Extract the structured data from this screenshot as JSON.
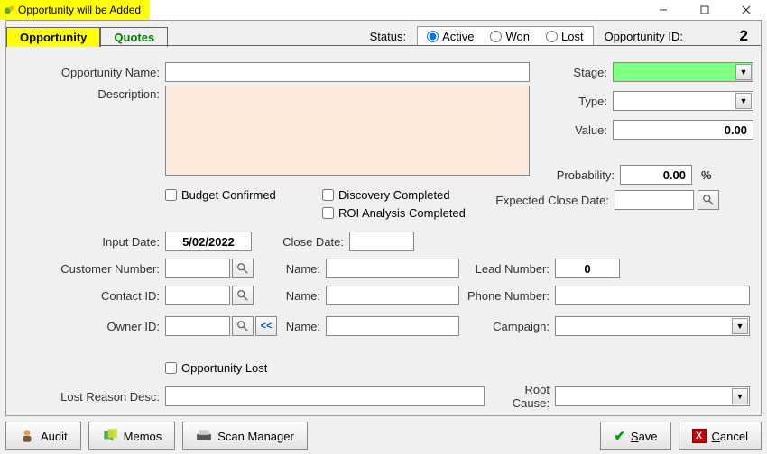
{
  "window": {
    "title": "Opportunity will be Added"
  },
  "tabs": {
    "opportunity": "Opportunity",
    "quotes": "Quotes"
  },
  "status": {
    "label": "Status:",
    "active": "Active",
    "won": "Won",
    "lost": "Lost",
    "selected": "active"
  },
  "opp_id": {
    "label": "Opportunity ID:",
    "value": "2"
  },
  "labels": {
    "opp_name": "Opportunity Name:",
    "description": "Description:",
    "stage": "Stage:",
    "type": "Type:",
    "value": "Value:",
    "probability": "Probability:",
    "pct": "%",
    "expected_close": "Expected Close Date:",
    "budget_confirmed": "Budget Confirmed",
    "discovery_completed": "Discovery Completed",
    "roi_completed": "ROI Analysis Completed",
    "input_date": "Input Date:",
    "close_date": "Close Date:",
    "customer_number": "Customer Number:",
    "contact_id": "Contact ID:",
    "owner_id": "Owner ID:",
    "name": "Name:",
    "name2": "Name:",
    "name3": "Name:",
    "lead_number": "Lead Number:",
    "phone_number": "Phone Number:",
    "campaign": "Campaign:",
    "opp_lost": "Opportunity Lost",
    "lost_reason": "Lost Reason Desc:",
    "root_cause": "Root Cause:"
  },
  "values": {
    "opp_name": "",
    "description": "",
    "stage": "",
    "type": "",
    "value": "0.00",
    "probability": "0.00",
    "expected_close": "",
    "input_date": "5/02/2022",
    "close_date": "",
    "customer_number": "",
    "contact_id": "",
    "owner_id": "",
    "name1": "",
    "name2": "",
    "name3": "",
    "lead_number": "0",
    "phone_number": "",
    "campaign": "",
    "lost_reason": "",
    "root_cause": ""
  },
  "footer": {
    "audit": "Audit",
    "memos": "Memos",
    "scan_manager": "Scan Manager",
    "save": "Save",
    "cancel": "Cancel"
  }
}
